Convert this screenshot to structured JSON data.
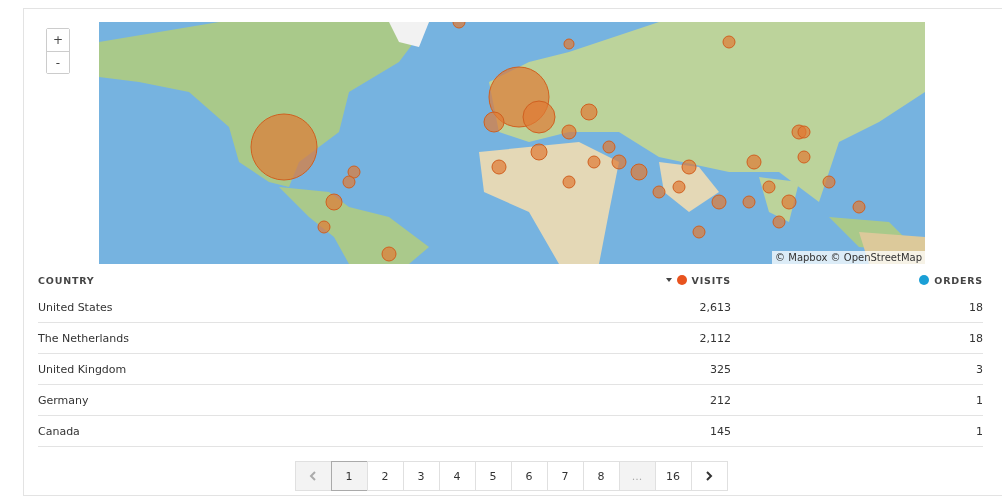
{
  "map": {
    "zoom_in": "+",
    "zoom_out": "-",
    "attribution": "© Mapbox © OpenStreetMap",
    "kind": "picture"
  },
  "table": {
    "columns": [
      {
        "label": "COUNTRY",
        "sorted": false
      },
      {
        "label": "VISITS",
        "sorted": true,
        "color": "#e8531e"
      },
      {
        "label": "ORDERS",
        "sorted": false,
        "color": "#1a9fd6"
      }
    ],
    "rows": [
      [
        "United States",
        "2,613",
        "18"
      ],
      [
        "The Netherlands",
        "2,112",
        "18"
      ],
      [
        "United Kingdom",
        "325",
        "3"
      ],
      [
        "Germany",
        "212",
        "1"
      ],
      [
        "Canada",
        "145",
        "1"
      ]
    ]
  },
  "pagination": {
    "prev_disabled": true,
    "next_disabled": false,
    "pages": [
      {
        "label": "1",
        "selected": true,
        "disabled": false
      },
      {
        "label": "2",
        "selected": false,
        "disabled": false
      },
      {
        "label": "3",
        "selected": false,
        "disabled": false
      },
      {
        "label": "4",
        "selected": false,
        "disabled": false
      },
      {
        "label": "5",
        "selected": false,
        "disabled": false
      },
      {
        "label": "6",
        "selected": false,
        "disabled": false
      },
      {
        "label": "7",
        "selected": false,
        "disabled": false
      },
      {
        "label": "8",
        "selected": false,
        "disabled": false
      },
      {
        "label": "...",
        "selected": false,
        "disabled": true
      },
      {
        "label": "16",
        "selected": false,
        "disabled": false
      }
    ]
  }
}
